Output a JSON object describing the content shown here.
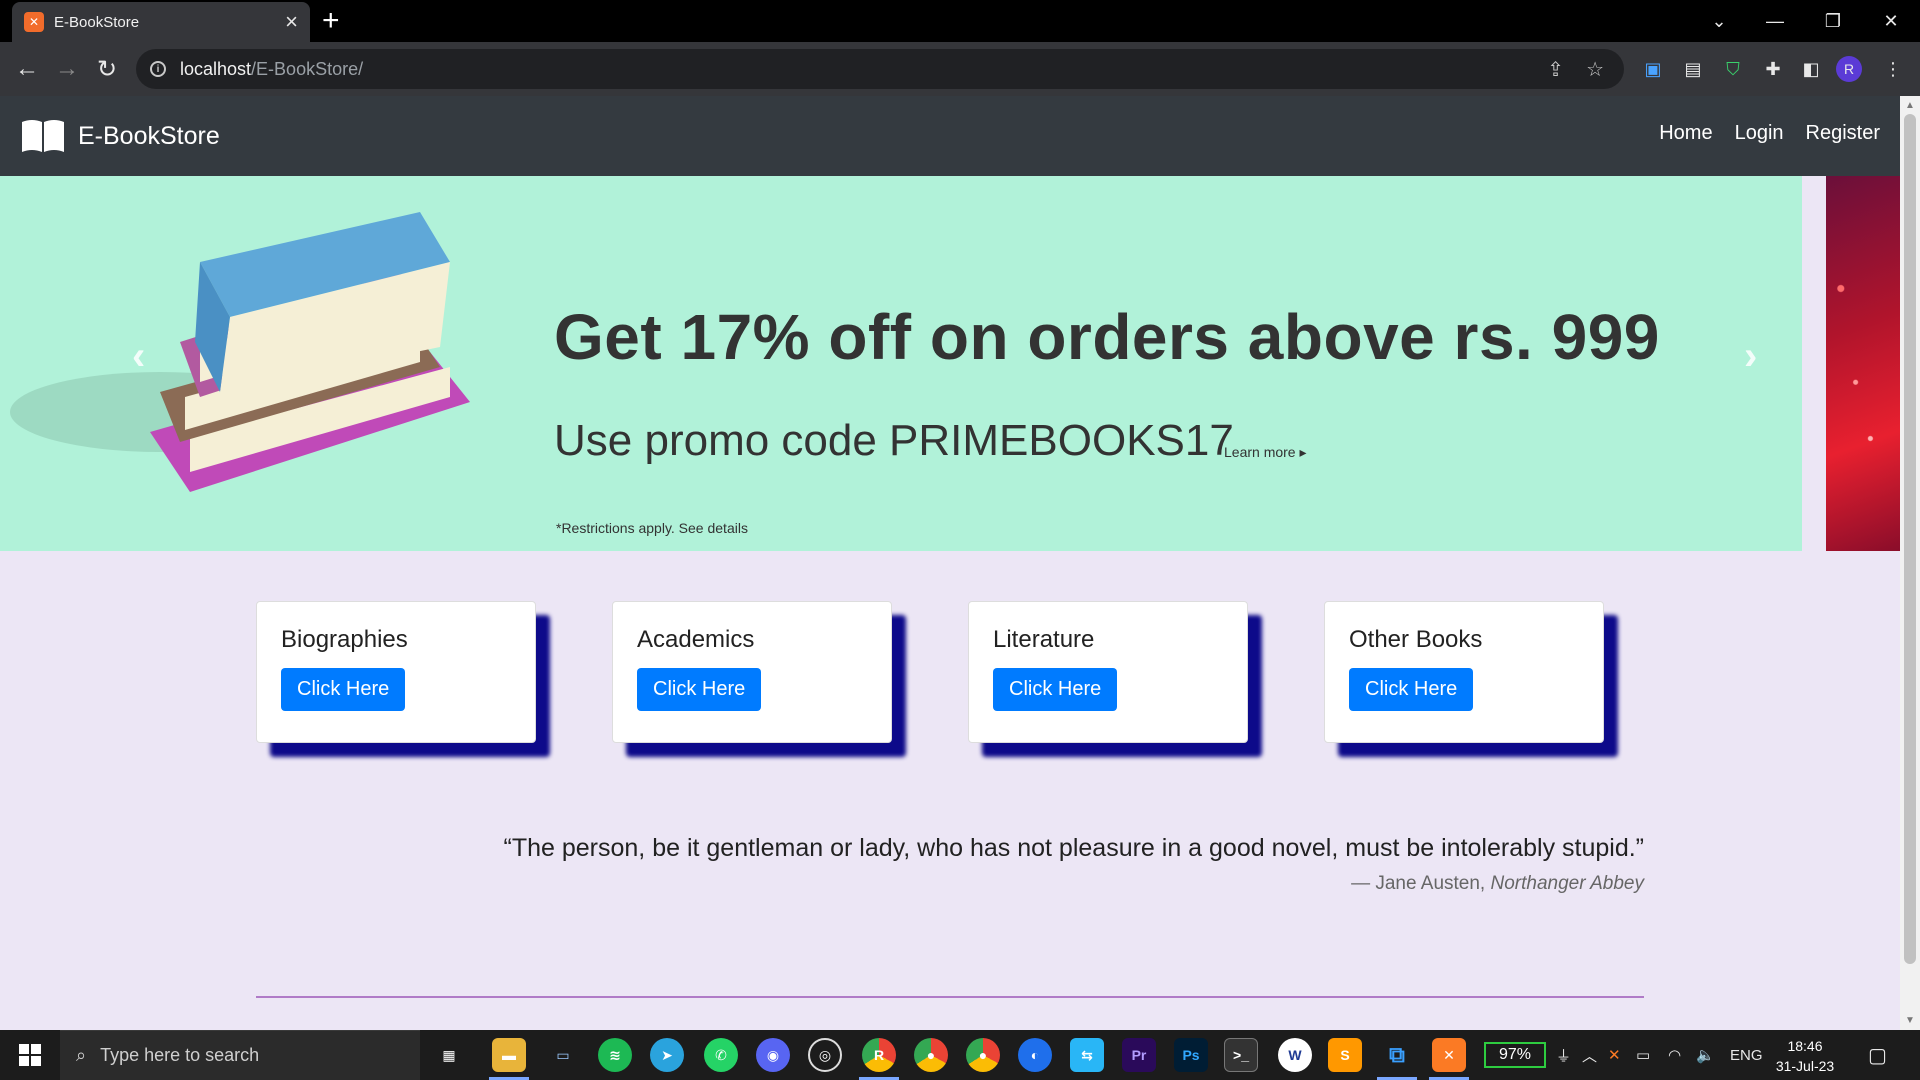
{
  "browser": {
    "tab_title": "E-BookStore",
    "tab_favicon": "xampp-icon",
    "url_host": "localhost",
    "url_path": "/E-BookStore/",
    "profile_initial": "R"
  },
  "site": {
    "brand": "E-BookStore",
    "nav": [
      "Home",
      "Login",
      "Register"
    ]
  },
  "banner": {
    "headline": "Get 17% off on orders above rs. 999",
    "promo": "Use promo code PRIMEBOOKS17",
    "learn_more": "Learn more ▸",
    "restrictions": "*Restrictions apply. See details",
    "prev_icon": "‹",
    "next_icon": "›"
  },
  "categories": [
    {
      "title": "Biographies",
      "button": "Click Here"
    },
    {
      "title": "Academics",
      "button": "Click Here"
    },
    {
      "title": "Literature",
      "button": "Click Here"
    },
    {
      "title": "Other Books",
      "button": "Click Here"
    }
  ],
  "quote": {
    "text": "“The person, be it gentleman or lady, who has not pleasure in a good novel, must be intolerably stupid.”",
    "attribution_prefix": "— Jane Austen, ",
    "source": "Northanger Abbey"
  },
  "taskbar": {
    "search_placeholder": "Type here to search",
    "battery": "97%",
    "language": "ENG",
    "time": "18:46",
    "date": "31-Jul-23"
  },
  "colors": {
    "navbar": "#343a40",
    "banner_bg": "#b1f2d9",
    "button": "#007bff",
    "card_shadow": "#0d0a8a",
    "page_bg": "#ece6f5",
    "divider": "#b07bc7"
  }
}
